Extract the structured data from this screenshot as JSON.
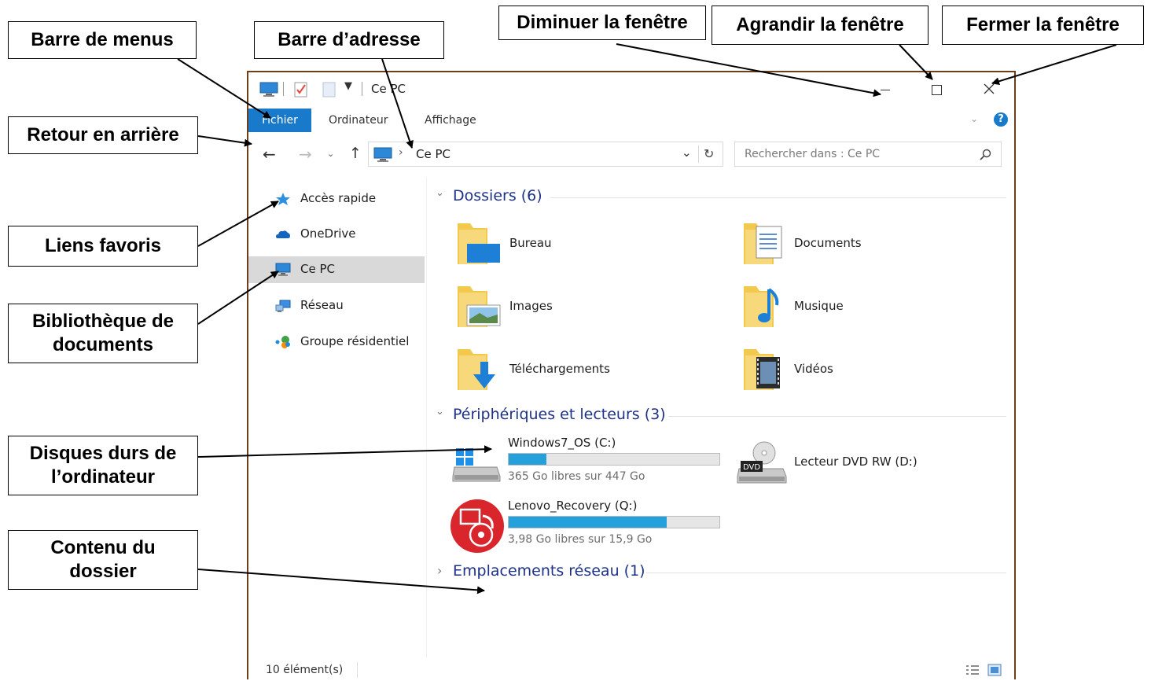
{
  "annotations": {
    "menu_bar": "Barre de menus",
    "address_bar": "Barre d’adresse",
    "minimize": "Diminuer la fenêtre",
    "maximize": "Agrandir la fenêtre",
    "close": "Fermer la fenêtre",
    "back": "Retour en arrière",
    "favorites": "Liens favoris",
    "library_line1": "Bibliothèque de",
    "library_line2": "documents",
    "drives_line1": "Disques durs de",
    "drives_line2": "l’ordinateur",
    "content_line1": "Contenu du",
    "content_line2": "dossier"
  },
  "window": {
    "title": "Ce PC",
    "ribbon_tabs": [
      "Fichier",
      "Ordinateur",
      "Affichage"
    ],
    "address": "Ce PC",
    "search_placeholder": "Rechercher dans : Ce PC",
    "status": "10 élément(s)"
  },
  "sidebar": {
    "items": [
      {
        "label": "Accès rapide",
        "icon": "star-icon"
      },
      {
        "label": "OneDrive",
        "icon": "cloud-icon"
      },
      {
        "label": "Ce PC",
        "icon": "computer-icon",
        "selected": true
      },
      {
        "label": "Réseau",
        "icon": "network-icon"
      },
      {
        "label": "Groupe résidentiel",
        "icon": "homegroup-icon"
      }
    ]
  },
  "content": {
    "folders_header": "Dossiers (6)",
    "folders": [
      "Bureau",
      "Documents",
      "Images",
      "Musique",
      "Téléchargements",
      "Vidéos"
    ],
    "devices_header": "Périphériques et lecteurs (3)",
    "drives": [
      {
        "name": "Windows7_OS (C:)",
        "free": "365 Go libres sur 447 Go",
        "used_fraction": 0.18
      },
      {
        "name": "Lecteur DVD RW (D:)"
      },
      {
        "name": "Lenovo_Recovery (Q:)",
        "free": "3,98 Go libres sur 15,9 Go",
        "used_fraction": 0.75
      }
    ],
    "network_header": "Emplacements réseau (1)"
  },
  "colors": {
    "accent": "#1979ca",
    "window_border": "#6b3f1c",
    "drive_fill": "#26a0da",
    "selected_nav": "#d9d9d9"
  }
}
